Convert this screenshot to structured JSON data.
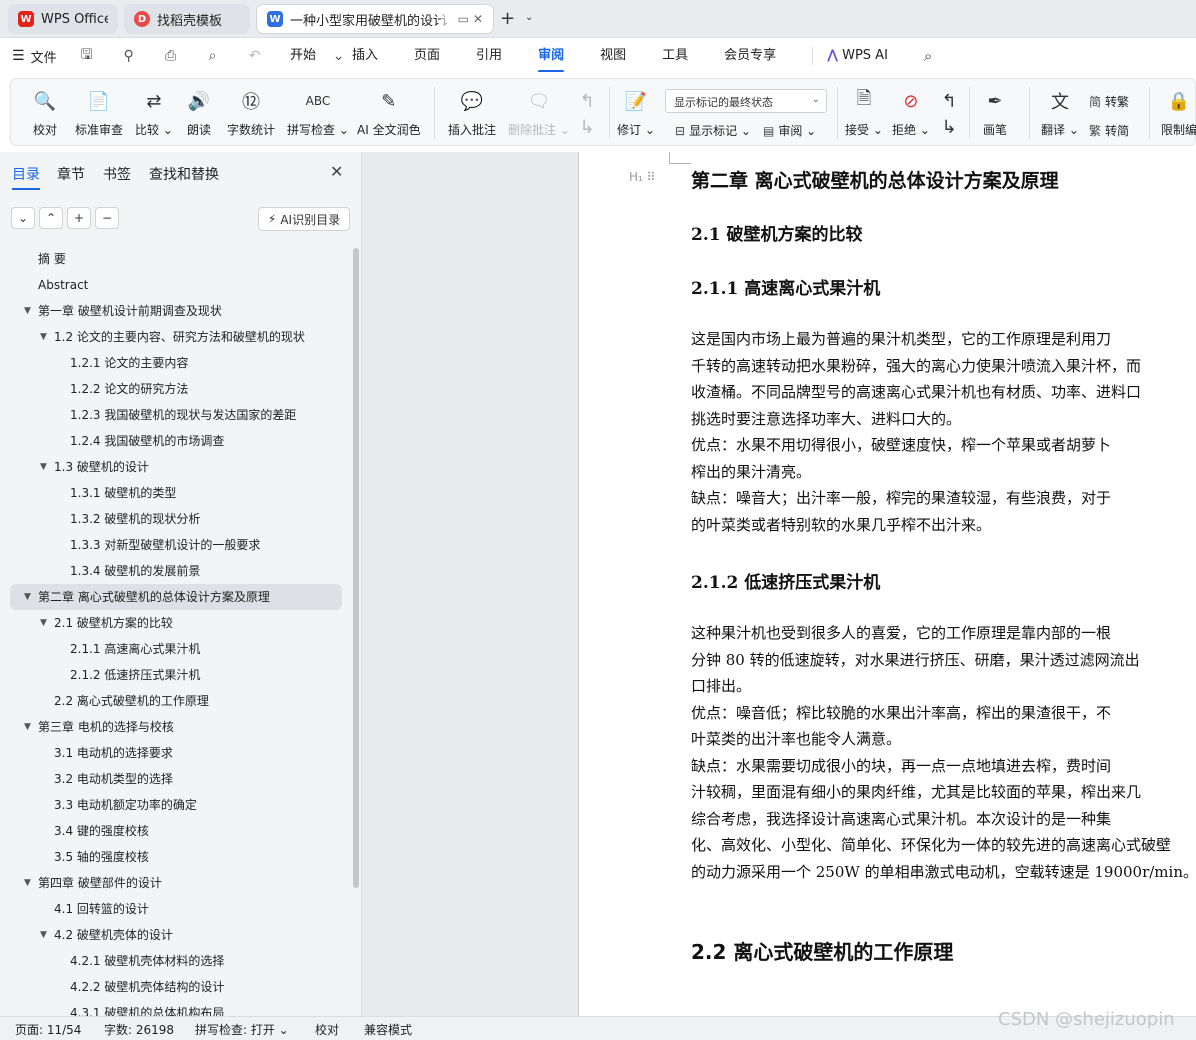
{
  "tabs": [
    {
      "label": "WPS Office"
    },
    {
      "label": "找稻壳模板"
    },
    {
      "label": "一种小型家用破壁机的设计",
      "suffix": "讠"
    }
  ],
  "menubar": {
    "file_label": "文件",
    "items": [
      "开始",
      "插入",
      "页面",
      "引用",
      "审阅",
      "视图",
      "工具",
      "会员专享",
      "WPS AI"
    ],
    "active": "审阅"
  },
  "ribbon": {
    "buttons": [
      "校对",
      "标准审查",
      "比较",
      "朗读",
      "字数统计",
      "拼写检查",
      "AI 全文润色",
      "插入批注",
      "删除批注",
      "修订",
      "接受",
      "拒绝",
      "画笔",
      "翻译",
      "限制编"
    ],
    "markup_select": "显示标记的最终状态",
    "show_markup": "显示标记",
    "review_pane": "审阅",
    "to_traditional": "转繁",
    "to_simplified": "转简"
  },
  "nav": {
    "tabs": [
      "目录",
      "章节",
      "书签",
      "查找和替换"
    ],
    "ai_button": "AI识别目录",
    "toc": [
      {
        "text": "摘    要",
        "level": 0,
        "arrow": false
      },
      {
        "text": "Abstract",
        "level": 0,
        "arrow": false
      },
      {
        "text": "第一章  破壁机设计前期调查及现状",
        "level": 0,
        "arrow": true
      },
      {
        "text": "1.2 论文的主要内容、研究方法和破壁机的现状",
        "level": 1,
        "arrow": true
      },
      {
        "text": "1.2.1 论文的主要内容",
        "level": 2,
        "arrow": false
      },
      {
        "text": "1.2.2 论文的研究方法",
        "level": 2,
        "arrow": false
      },
      {
        "text": "1.2.3 我国破壁机的现状与发达国家的差距",
        "level": 2,
        "arrow": false
      },
      {
        "text": "1.2.4 我国破壁机的市场调查",
        "level": 2,
        "arrow": false
      },
      {
        "text": "1.3  破壁机的设计",
        "level": 1,
        "arrow": true
      },
      {
        "text": "1.3.1 破壁机的类型",
        "level": 2,
        "arrow": false
      },
      {
        "text": "1.3.2  破壁机的现状分析",
        "level": 2,
        "arrow": false
      },
      {
        "text": "1.3.3 对新型破壁机设计的一般要求",
        "level": 2,
        "arrow": false
      },
      {
        "text": "1.3.4  破壁机的发展前景",
        "level": 2,
        "arrow": false
      },
      {
        "text": "第二章  离心式破壁机的总体设计方案及原理",
        "level": 0,
        "arrow": true,
        "selected": true
      },
      {
        "text": "2.1  破壁机方案的比较",
        "level": 1,
        "arrow": true
      },
      {
        "text": "2.1.1 高速离心式果汁机",
        "level": 2,
        "arrow": false
      },
      {
        "text": "2.1.2  低速挤压式果汁机",
        "level": 2,
        "arrow": false
      },
      {
        "text": "2.2 离心式破壁机的工作原理",
        "level": 1,
        "arrow": false
      },
      {
        "text": "第三章  电机的选择与校核",
        "level": 0,
        "arrow": true
      },
      {
        "text": "3.1  电动机的选择要求",
        "level": 1,
        "arrow": false
      },
      {
        "text": "3.2  电动机类型的选择",
        "level": 1,
        "arrow": false
      },
      {
        "text": "3.3  电动机额定功率的确定",
        "level": 1,
        "arrow": false
      },
      {
        "text": "3.4  键的强度校核",
        "level": 1,
        "arrow": false
      },
      {
        "text": "3.5  轴的强度校核",
        "level": 1,
        "arrow": false
      },
      {
        "text": "第四章     破壁部件的设计",
        "level": 0,
        "arrow": true
      },
      {
        "text": "4.1  回转篮的设计",
        "level": 1,
        "arrow": false
      },
      {
        "text": "4.2 破壁机壳体的设计",
        "level": 1,
        "arrow": true
      },
      {
        "text": "4.2.1  破壁机壳体材料的选择",
        "level": 2,
        "arrow": false
      },
      {
        "text": "4.2.2 破壁机壳体结构的设计",
        "level": 2,
        "arrow": false
      },
      {
        "text": "4.3.1 破壁机的总体机构布局",
        "level": 2,
        "arrow": false
      }
    ]
  },
  "document": {
    "chapter_title": "第二章  离心式破壁机的总体设计方案及原理",
    "h_2_1": "2.1  破壁机方案的比较",
    "h_2_1_1": "2.1.1 高速离心式果汁机",
    "p1": [
      "        这是国内市场上最为普遍的果汁机类型，它的工作原理是利用刀",
      "千转的高速转动把水果粉碎，强大的离心力使果汁喷流入果汁杯，而",
      "收渣桶。不同品牌型号的高速离心式果汁机也有材质、功率、进料口",
      "挑选时要注意选择功率大、进料口大的。",
      "        优点：水果不用切得很小，破壁速度快，榨一个苹果或者胡萝卜",
      "榨出的果汁清亮。",
      "        缺点：噪音大；出汁率一般，榨完的果渣较湿，有些浪费，对于",
      "的叶菜类或者特别软的水果几乎榨不出汁来。"
    ],
    "h_2_1_2": "2.1.2  低速挤压式果汁机",
    "p2": [
      "        这种果汁机也受到很多人的喜爱，它的工作原理是靠内部的一根",
      "分钟 80 转的低速旋转，对水果进行挤压、研磨，果汁透过滤网流出",
      "口排出。",
      "        优点：噪音低；榨比较脆的水果出汁率高，榨出的果渣很干，不",
      "叶菜类的出汁率也能令人满意。",
      "        缺点：水果需要切成很小的块，再一点一点地填进去榨，费时间",
      "汁较稠，里面混有细小的果肉纤维，尤其是比较面的苹果，榨出来几",
      "        综合考虑，我选择设计高速离心式果汁机。本次设计的是一种集",
      "化、高效化、小型化、简单化、环保化为一体的较先进的高速离心式破壁",
      "的动力源采用一个 250W 的单相串激式电动机，空载转速是 19000r/min。"
    ],
    "h_2_2": "2.2 离心式破壁机的工作原理"
  },
  "statusbar": {
    "page": "页面: 11/54",
    "words": "字数: 26198",
    "spell": "拼写检查: 打开",
    "proof": "校对",
    "compat": "兼容模式"
  },
  "watermark": "CSDN @shejizuopin",
  "colors": {
    "accent": "#1a66e8",
    "wps_red": "#e2231a",
    "doc_blue": "#2f6fe4"
  }
}
